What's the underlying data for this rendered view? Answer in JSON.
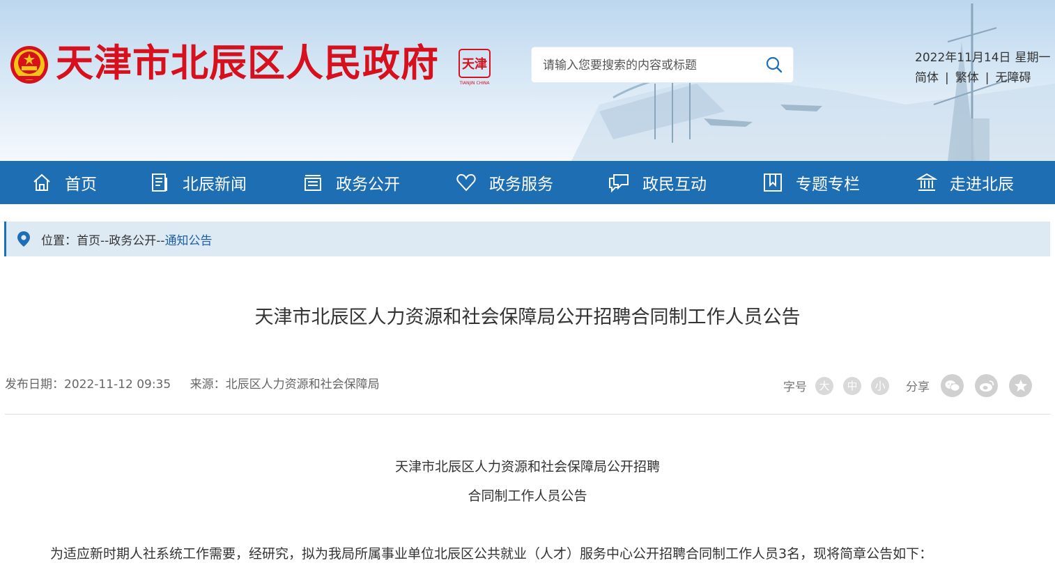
{
  "header": {
    "site_title": "天津市北辰区人民政府",
    "seal_text": "天津",
    "seal_sub": "TIANJIN CHINA",
    "search_placeholder": "请输入您要搜索的内容或标题",
    "date": "2022年11月14日",
    "weekday": "星期一",
    "lang_options": [
      "简体",
      "繁体",
      "无障碍"
    ],
    "lang_separator": "|"
  },
  "nav": {
    "items": [
      {
        "label": "首页",
        "icon": "home-icon"
      },
      {
        "label": "北辰新闻",
        "icon": "news-icon"
      },
      {
        "label": "政务公开",
        "icon": "list-icon"
      },
      {
        "label": "政务服务",
        "icon": "heart-icon"
      },
      {
        "label": "政民互动",
        "icon": "chat-icon"
      },
      {
        "label": "专题专栏",
        "icon": "bookmark-icon"
      },
      {
        "label": "走进北辰",
        "icon": "building-icon"
      }
    ]
  },
  "breadcrumb": {
    "prefix": "位置：",
    "items": [
      "首页",
      "政务公开",
      "通知公告"
    ],
    "separator": "--"
  },
  "article": {
    "title": "天津市北辰区人力资源和社会保障局公开招聘合同制工作人员公告",
    "date_label": "发布日期：",
    "date": "2022-11-12 09:35",
    "source_label": "来源：",
    "source": "北辰区人力资源和社会保障局",
    "font_size_label": "字号",
    "font_sizes": [
      "大",
      "中",
      "小"
    ],
    "share_label": "分享",
    "share_icons": [
      "wechat-icon",
      "weibo-icon",
      "favorite-icon"
    ],
    "body_title_line1": "天津市北辰区人力资源和社会保障局公开招聘",
    "body_title_line2": "合同制工作人员公告",
    "paragraph1": "为适应新时期人社系统工作需要，经研究，拟为我局所属事业单位北辰区公共就业（人才）服务中心公开招聘合同制工作人员3名，现将简章公告如下："
  },
  "colors": {
    "title_red": "#d6101c",
    "nav_blue": "#1e6eb4",
    "crumb_bg": "#dde9f3",
    "link_blue": "#1e5fa8"
  }
}
